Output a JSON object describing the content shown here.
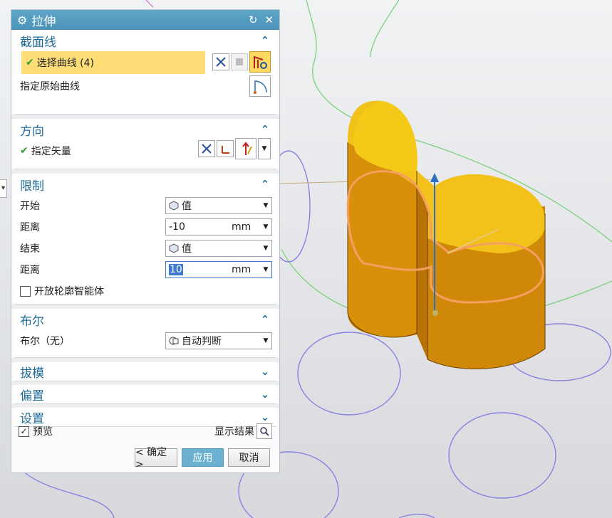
{
  "dialog": {
    "title": "拉伸",
    "sections": {
      "section_curve": {
        "title": "截面线",
        "select_curve_label": "选择曲线 (4)",
        "original_curve_label": "指定原始曲线"
      },
      "direction": {
        "title": "方向",
        "vector_label": "指定矢量"
      },
      "limits": {
        "title": "限制",
        "start_label": "开始",
        "start_value": "值",
        "start_distance_label": "距离",
        "start_distance": "-10",
        "start_unit": "mm",
        "end_label": "结束",
        "end_value": "值",
        "end_distance_label": "距离",
        "end_distance": "10",
        "end_unit": "mm",
        "open_profile_label": "开放轮廓智能体",
        "open_profile_checked": false
      },
      "boolean": {
        "title": "布尔",
        "label": "布尔（无）",
        "value": "自动判断"
      },
      "draft": {
        "title": "拔模"
      },
      "offset": {
        "title": "偏置"
      },
      "settings": {
        "title": "设置"
      }
    },
    "preview_label": "预览",
    "preview_checked": true,
    "show_result_label": "显示结果",
    "buttons": {
      "ok": "< 确定 >",
      "apply": "应用",
      "cancel": "取消"
    }
  },
  "colors": {
    "title_bar": "#4a93b8",
    "section_header": "#1f6b97",
    "highlight_row": "#ffde78",
    "apply_button": "#6bb1cf",
    "solid_body": "#d8900a",
    "solid_top": "#f2c21a",
    "profile_curve": "#f5a060"
  }
}
